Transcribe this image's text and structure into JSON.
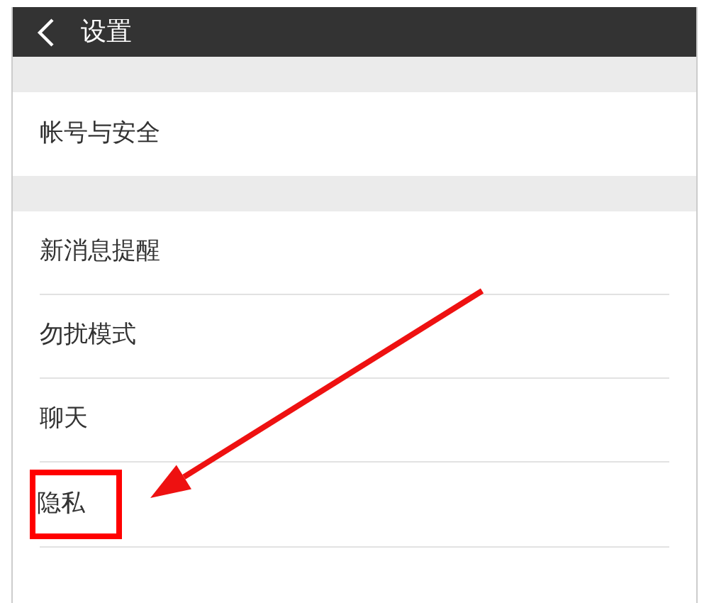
{
  "header": {
    "title": "设置"
  },
  "groups": [
    {
      "items": [
        {
          "label": "帐号与安全",
          "highlighted": false
        }
      ]
    },
    {
      "items": [
        {
          "label": "新消息提醒",
          "highlighted": false
        },
        {
          "label": "勿扰模式",
          "highlighted": false
        },
        {
          "label": "聊天",
          "highlighted": false
        },
        {
          "label": "隐私",
          "highlighted": true
        }
      ]
    }
  ]
}
